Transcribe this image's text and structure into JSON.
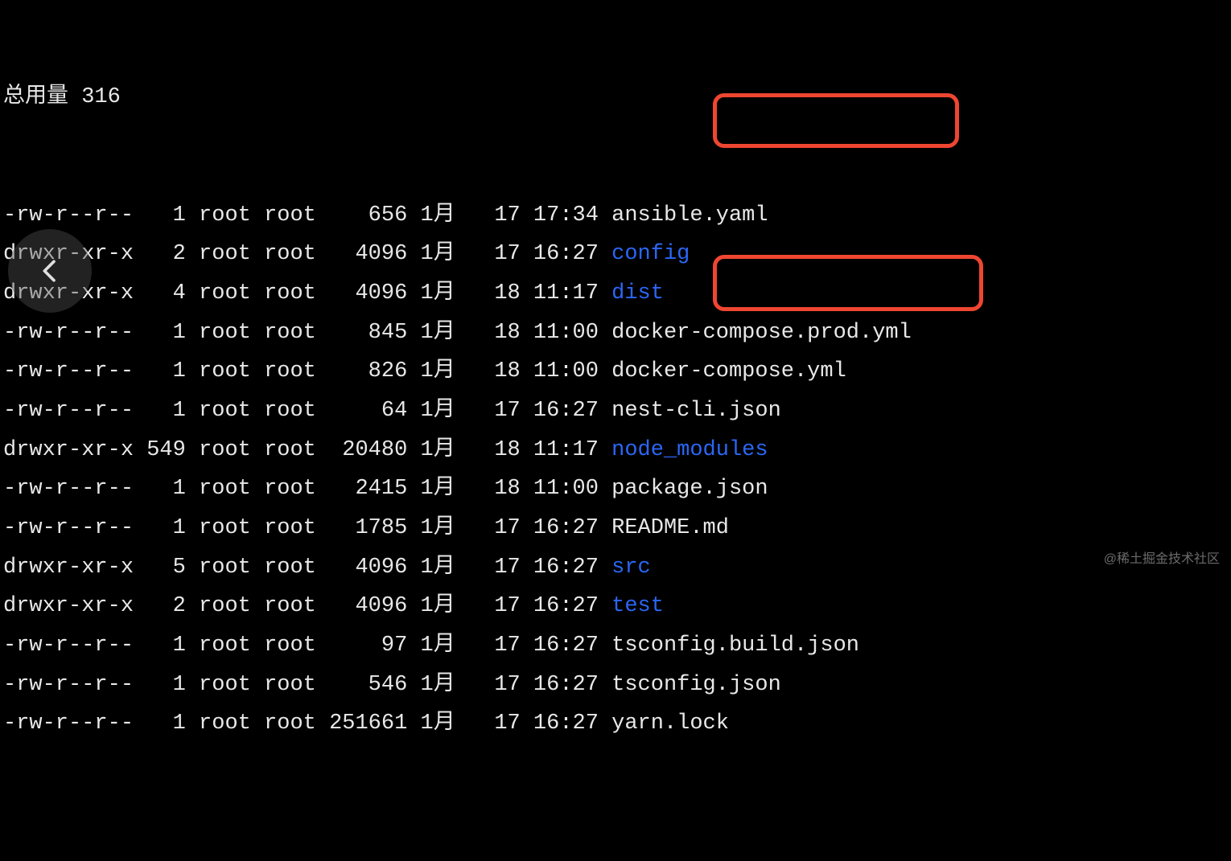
{
  "header": {
    "total_label": "总用量",
    "total_value": "316"
  },
  "rows": [
    {
      "perm": "-rw-r--r--",
      "links": "1",
      "owner": "root",
      "group": "root",
      "size": "656",
      "month": "1月",
      "day": "17",
      "time": "17:34",
      "name": "ansible.yaml",
      "type": "file"
    },
    {
      "perm": "drwxr-xr-x",
      "links": "2",
      "owner": "root",
      "group": "root",
      "size": "4096",
      "month": "1月",
      "day": "17",
      "time": "16:27",
      "name": "config",
      "type": "dir"
    },
    {
      "perm": "drwxr-xr-x",
      "links": "4",
      "owner": "root",
      "group": "root",
      "size": "4096",
      "month": "1月",
      "day": "18",
      "time": "11:17",
      "name": "dist",
      "type": "dir"
    },
    {
      "perm": "-rw-r--r--",
      "links": "1",
      "owner": "root",
      "group": "root",
      "size": "845",
      "month": "1月",
      "day": "18",
      "time": "11:00",
      "name": "docker-compose.prod.yml",
      "type": "file"
    },
    {
      "perm": "-rw-r--r--",
      "links": "1",
      "owner": "root",
      "group": "root",
      "size": "826",
      "month": "1月",
      "day": "18",
      "time": "11:00",
      "name": "docker-compose.yml",
      "type": "file"
    },
    {
      "perm": "-rw-r--r--",
      "links": "1",
      "owner": "root",
      "group": "root",
      "size": "64",
      "month": "1月",
      "day": "17",
      "time": "16:27",
      "name": "nest-cli.json",
      "type": "file"
    },
    {
      "perm": "drwxr-xr-x",
      "links": "549",
      "owner": "root",
      "group": "root",
      "size": "20480",
      "month": "1月",
      "day": "18",
      "time": "11:17",
      "name": "node_modules",
      "type": "dir"
    },
    {
      "perm": "-rw-r--r--",
      "links": "1",
      "owner": "root",
      "group": "root",
      "size": "2415",
      "month": "1月",
      "day": "18",
      "time": "11:00",
      "name": "package.json",
      "type": "file"
    },
    {
      "perm": "-rw-r--r--",
      "links": "1",
      "owner": "root",
      "group": "root",
      "size": "1785",
      "month": "1月",
      "day": "17",
      "time": "16:27",
      "name": "README.md",
      "type": "file"
    },
    {
      "perm": "drwxr-xr-x",
      "links": "5",
      "owner": "root",
      "group": "root",
      "size": "4096",
      "month": "1月",
      "day": "17",
      "time": "16:27",
      "name": "src",
      "type": "dir"
    },
    {
      "perm": "drwxr-xr-x",
      "links": "2",
      "owner": "root",
      "group": "root",
      "size": "4096",
      "month": "1月",
      "day": "17",
      "time": "16:27",
      "name": "test",
      "type": "dir"
    },
    {
      "perm": "-rw-r--r--",
      "links": "1",
      "owner": "root",
      "group": "root",
      "size": "97",
      "month": "1月",
      "day": "17",
      "time": "16:27",
      "name": "tsconfig.build.json",
      "type": "file"
    },
    {
      "perm": "-rw-r--r--",
      "links": "1",
      "owner": "root",
      "group": "root",
      "size": "546",
      "month": "1月",
      "day": "17",
      "time": "16:27",
      "name": "tsconfig.json",
      "type": "file"
    },
    {
      "perm": "-rw-r--r--",
      "links": "1",
      "owner": "root",
      "group": "root",
      "size": "251661",
      "month": "1月",
      "day": "17",
      "time": "16:27",
      "name": "yarn.lock",
      "type": "file"
    }
  ],
  "watermark": "@稀土掘金技术社区",
  "colors": {
    "dir": "#2b66f6",
    "fg": "#e8e8e8",
    "highlight": "#ef4631"
  }
}
